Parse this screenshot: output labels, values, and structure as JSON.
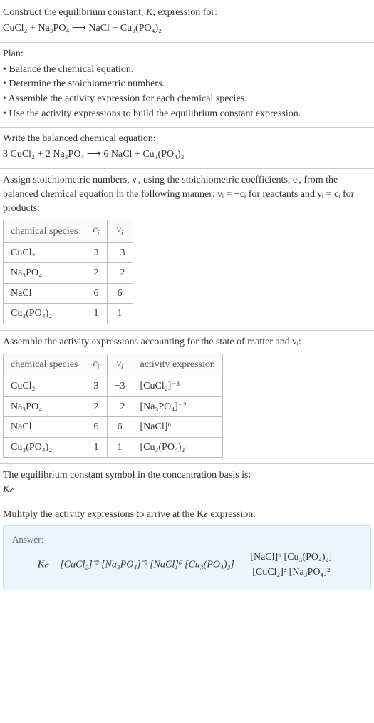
{
  "intro": {
    "line1": "Construct the equilibrium constant, K, expression for:",
    "reaction_unbalanced": "CuCl₂ + Na₃PO₄ ⟶ NaCl + Cu₃(PO₄)₂"
  },
  "plan": {
    "heading": "Plan:",
    "items": [
      "• Balance the chemical equation.",
      "• Determine the stoichiometric numbers.",
      "• Assemble the activity expression for each chemical species.",
      "• Use the activity expressions to build the equilibrium constant expression."
    ]
  },
  "balanced": {
    "heading": "Write the balanced chemical equation:",
    "reaction_balanced": "3 CuCl₂ + 2 Na₃PO₄ ⟶ 6 NaCl + Cu₃(PO₄)₂"
  },
  "stoich": {
    "intro": "Assign stoichiometric numbers, νᵢ, using the stoichiometric coefficients, cᵢ, from the balanced chemical equation in the following manner: νᵢ = −cᵢ for reactants and νᵢ = cᵢ for products:",
    "headers": {
      "species": "chemical species",
      "ci": "cᵢ",
      "vi": "νᵢ"
    },
    "rows": [
      {
        "species": "CuCl₂",
        "ci": "3",
        "vi": "−3"
      },
      {
        "species": "Na₃PO₄",
        "ci": "2",
        "vi": "−2"
      },
      {
        "species": "NaCl",
        "ci": "6",
        "vi": "6"
      },
      {
        "species": "Cu₃(PO₄)₂",
        "ci": "1",
        "vi": "1"
      }
    ]
  },
  "activity": {
    "intro": "Assemble the activity expressions accounting for the state of matter and νᵢ:",
    "headers": {
      "species": "chemical species",
      "ci": "cᵢ",
      "vi": "νᵢ",
      "act": "activity expression"
    },
    "rows": [
      {
        "species": "CuCl₂",
        "ci": "3",
        "vi": "−3",
        "act": "[CuCl₂]⁻³"
      },
      {
        "species": "Na₃PO₄",
        "ci": "2",
        "vi": "−2",
        "act": "[Na₃PO₄]⁻²"
      },
      {
        "species": "NaCl",
        "ci": "6",
        "vi": "6",
        "act": "[NaCl]⁶"
      },
      {
        "species": "Cu₃(PO₄)₂",
        "ci": "1",
        "vi": "1",
        "act": "[Cu₃(PO₄)₂]"
      }
    ]
  },
  "symbol": {
    "line1": "The equilibrium constant symbol in the concentration basis is:",
    "kc": "K𝒸"
  },
  "multiply": {
    "line": "Mulitply the activity expressions to arrive at the K𝒸 expression:"
  },
  "answer": {
    "label": "Answer:",
    "lhs": "K𝒸 = [CuCl₂]⁻³ [Na₃PO₄]⁻² [NaCl]⁶ [Cu₃(PO₄)₂] = ",
    "frac_num": "[NaCl]⁶ [Cu₃(PO₄)₂]",
    "frac_den": "[CuCl₂]³ [Na₃PO₄]²"
  }
}
